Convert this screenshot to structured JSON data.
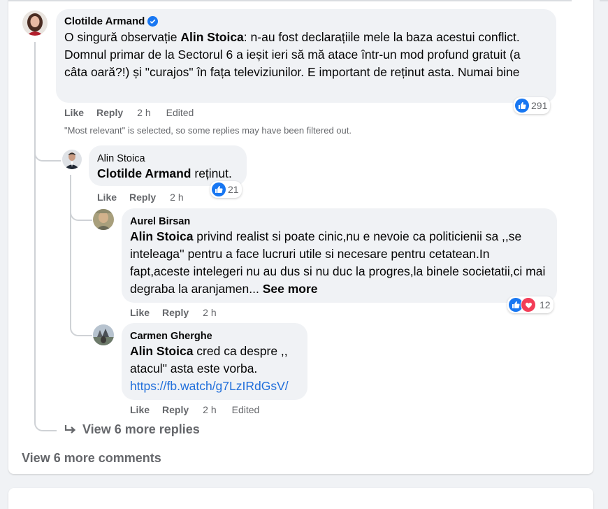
{
  "comment": {
    "author": "Clotilde Armand",
    "verified_icon": "verified-badge-icon",
    "mention": "Alin Stoica",
    "text_before": "O singură observație",
    "text_after": ": n-au fost declarațiile mele la baza acestui conflict. Domnul primar de la Sectorul 6 a ieșit ieri să mă atace într-un mod profund gratuit (a câta oară?!) și \"curajos\" în fața televiziunilor. E important de reținut asta. Numai bine",
    "like": "Like",
    "reply": "Reply",
    "time": "2 h",
    "edited": "Edited",
    "reactions": "291"
  },
  "filter_note": "\"Most relevant\" is selected, so some replies may have been filtered out.",
  "replies": [
    {
      "author": "Alin Stoica",
      "mention": "Clotilde Armand",
      "text": " reținut.",
      "like": "Like",
      "reply": "Reply",
      "time": "2 h",
      "reactions": "21"
    },
    {
      "author": "Aurel Birsan",
      "mention": "Alin Stoica",
      "text": " privind realist si poate cinic,nu e nevoie ca politicienii sa ,,se inteleaga'' pentru a face lucruri utile si necesare pentru cetatean.In fapt,aceste intelegeri nu au dus si nu duc la progres,la binele societatii,ci mai degraba la aranjamen... ",
      "see_more": "See more",
      "like": "Like",
      "reply": "Reply",
      "time": "2 h",
      "reactions": "12"
    },
    {
      "author": "Carmen Gherghe",
      "mention": "Alin Stoica",
      "text": " cred ca despre ,, atacul\" asta este vorba.",
      "link": "https://fb.watch/g7LzIRdGsV/",
      "like": "Like",
      "reply": "Reply",
      "time": "2 h",
      "edited": "Edited"
    }
  ],
  "view_more_replies": "View 6 more replies",
  "view_more_comments": "View 6 more comments",
  "colors": {
    "like_blue": "#1877f2",
    "love_red": "#f33e58",
    "link": "#216fdb",
    "bubble": "#f0f2f5"
  }
}
